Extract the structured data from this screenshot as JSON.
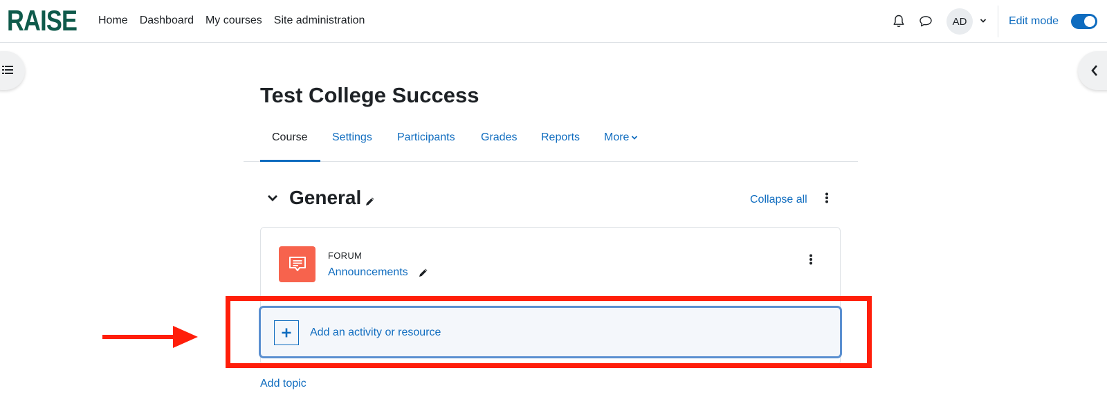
{
  "header": {
    "logo_text": "RAISE",
    "nav": [
      "Home",
      "Dashboard",
      "My courses",
      "Site administration"
    ],
    "avatar_initials": "AD",
    "edit_mode_label": "Edit mode",
    "edit_mode_on": true
  },
  "page": {
    "title": "Test College Success",
    "tabs": [
      {
        "label": "Course",
        "active": true
      },
      {
        "label": "Settings"
      },
      {
        "label": "Participants"
      },
      {
        "label": "Grades"
      },
      {
        "label": "Reports"
      },
      {
        "label": "More"
      }
    ]
  },
  "section": {
    "title": "General",
    "collapse_all_label": "Collapse all",
    "activity": {
      "type_label": "FORUM",
      "name": "Announcements"
    },
    "add_activity_label": "Add an activity or resource",
    "add_topic_label": "Add topic"
  },
  "colors": {
    "brand": "#0f5a4b",
    "link": "#0f6cbf",
    "forum_icon_bg": "#f7634d",
    "annotation": "#ff1e0a"
  }
}
